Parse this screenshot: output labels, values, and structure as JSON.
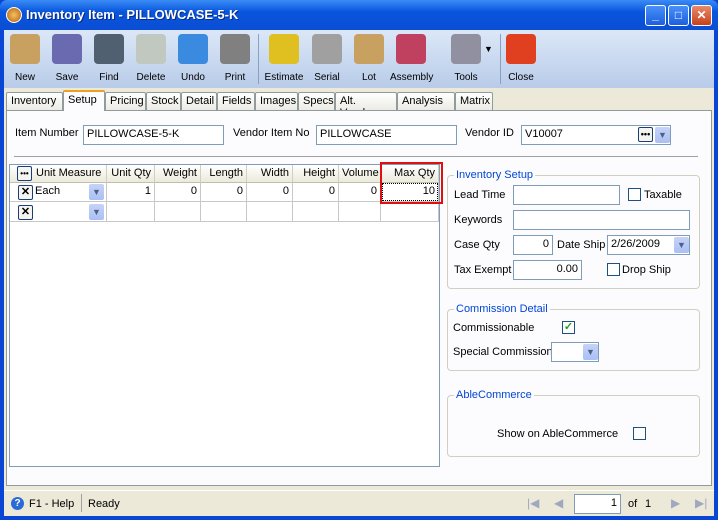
{
  "window": {
    "title": "Inventory Item - PILLOWCASE-5-K",
    "buttons": [
      "_",
      "□",
      "✕"
    ]
  },
  "toolbar": {
    "items": [
      {
        "label": "New",
        "icon": "new-icon",
        "color": "#c8a060"
      },
      {
        "label": "Save",
        "icon": "save-icon",
        "color": "#6a6ab0"
      },
      {
        "label": "Find",
        "icon": "binoculars-icon",
        "color": "#506070"
      },
      {
        "label": "Delete",
        "icon": "recycle-bin-icon",
        "color": "#c0c8c0"
      },
      {
        "label": "Undo",
        "icon": "undo-icon",
        "color": "#3a8ae0"
      },
      {
        "label": "Print",
        "icon": "printer-icon",
        "color": "#808080"
      },
      {
        "label": "Estimate",
        "icon": "estimate-icon",
        "color": "#e0c020"
      },
      {
        "label": "Serial",
        "icon": "barcode-icon",
        "color": "#a0a0a0"
      },
      {
        "label": "Lot",
        "icon": "lot-icon",
        "color": "#c8a060"
      },
      {
        "label": "Assembly",
        "icon": "assembly-icon",
        "color": "#c04060"
      },
      {
        "label": "Tools",
        "icon": "tools-icon",
        "color": "#9090a0"
      },
      {
        "label": "Close",
        "icon": "close-window-icon",
        "color": "#e04020"
      }
    ]
  },
  "tabs": [
    "Inventory",
    "Setup",
    "Pricing",
    "Stock",
    "Detail",
    "Fields",
    "Images",
    "Specs",
    "Alt. Vendors",
    "Analysis",
    "Matrix"
  ],
  "active_tab": "Setup",
  "header": {
    "item_number_label": "Item Number",
    "item_number": "PILLOWCASE-5-K",
    "vendor_item_label": "Vendor Item No",
    "vendor_item": "PILLOWCASE",
    "vendor_id_label": "Vendor ID",
    "vendor_id": "V10007"
  },
  "grid": {
    "columns": [
      "Unit Measure",
      "Unit Qty",
      "Weight",
      "Length",
      "Width",
      "Height",
      "Volume",
      "Max Qty"
    ],
    "rows": [
      [
        "Each",
        "1",
        "0",
        "0",
        "0",
        "0",
        "0",
        "10"
      ],
      [
        "",
        "",
        "",
        "",
        "",
        "",
        "",
        ""
      ]
    ]
  },
  "inventory_setup": {
    "title": "Inventory Setup",
    "lead_time_label": "Lead Time",
    "lead_time": "",
    "taxable_label": "Taxable",
    "taxable": false,
    "keywords_label": "Keywords",
    "keywords": "",
    "case_qty_label": "Case Qty",
    "case_qty": "0",
    "date_ship_label": "Date Ship",
    "date_ship": "2/26/2009",
    "tax_exempt_label": "Tax Exempt",
    "tax_exempt": "0.00",
    "drop_ship_label": "Drop Ship",
    "drop_ship": false
  },
  "commission": {
    "title": "Commission Detail",
    "commissionable_label": "Commissionable",
    "commissionable": true,
    "special_label": "Special Commission",
    "special": ""
  },
  "ablecommerce": {
    "title": "AbleCommerce",
    "show_label": "Show on AbleCommerce",
    "show": false
  },
  "status": {
    "help": "F1 - Help",
    "text": "Ready",
    "page": "1",
    "of_label": "of",
    "total": "1"
  }
}
